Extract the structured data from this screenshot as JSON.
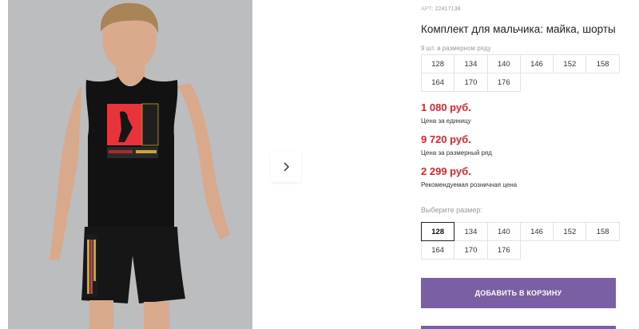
{
  "product": {
    "sku_prefix": "АРТ:",
    "sku": "22417138",
    "title": "Комплект для мальчика: майка, шорты",
    "pack_label": "9 шт. в размерном ряду",
    "pack_sizes": [
      "128",
      "134",
      "140",
      "146",
      "152",
      "158",
      "164",
      "170",
      "176"
    ]
  },
  "prices": [
    {
      "amount": "1 080 руб.",
      "note": "Цена за единицу"
    },
    {
      "amount": "9 720 руб.",
      "note": "Цена за размерный ряд"
    },
    {
      "amount": "2 299 руб.",
      "note": "Рекомендуемая розничная цена"
    }
  ],
  "size_select": {
    "label": "Выберите размер:",
    "options": [
      "128",
      "134",
      "140",
      "146",
      "152",
      "158",
      "164",
      "170",
      "176"
    ],
    "selected": "128"
  },
  "cart_button": {
    "label": "ДОБАВИТЬ В КОРЗИНУ"
  },
  "colors": {
    "price": "#e2232e",
    "accent": "#7a5fa4",
    "photo_bg": "#bcbdbe"
  },
  "icons": {
    "next": "chevron-right-icon"
  }
}
